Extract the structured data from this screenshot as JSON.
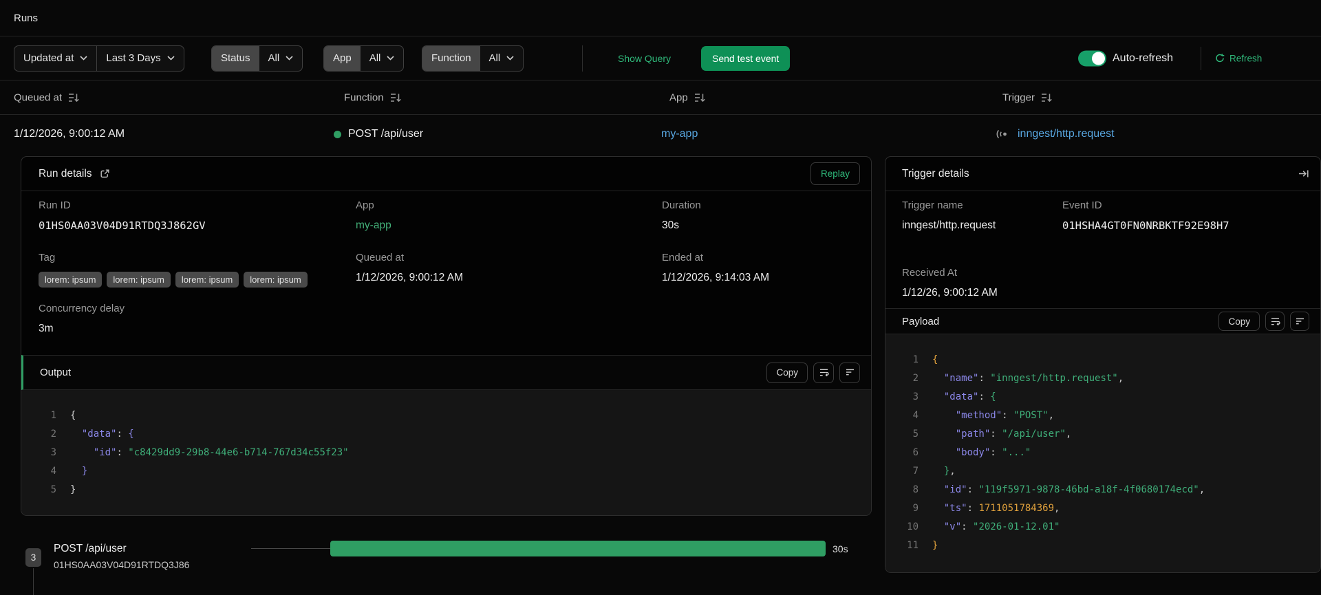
{
  "page": {
    "title": "Runs"
  },
  "filters": {
    "sort_field": "Updated at",
    "time_range": "Last 3 Days",
    "status_label": "Status",
    "status_value": "All",
    "app_label": "App",
    "app_value": "All",
    "function_label": "Function",
    "function_value": "All",
    "show_query_label": "Show Query",
    "send_test_event_label": "Send test event",
    "auto_refresh_label": "Auto-refresh",
    "auto_refresh_state": "on",
    "refresh_label": "Refresh"
  },
  "table": {
    "columns": [
      "Queued at",
      "Function",
      "App",
      "Trigger"
    ],
    "row": {
      "queued_at": "1/12/2026, 9:00:12 AM",
      "function": "POST /api/user",
      "status": "completed",
      "app": "my-app",
      "trigger": "inngest/http.request"
    }
  },
  "run_details": {
    "title": "Run details",
    "replay_label": "Replay",
    "run_id_label": "Run ID",
    "run_id": "01HS0AA03V04D91RTDQ3J862GV",
    "app_label": "App",
    "app": "my-app",
    "duration_label": "Duration",
    "duration": "30s",
    "tag_label": "Tag",
    "tags": [
      "lorem: ipsum",
      "lorem: ipsum",
      "lorem: ipsum",
      "lorem: ipsum"
    ],
    "queued_at_label": "Queued at",
    "queued_at": "1/12/2026, 9:00:12 AM",
    "ended_at_label": "Ended at",
    "ended_at": "1/12/2026, 9:14:03 AM",
    "concurrency_label": "Concurrency delay",
    "concurrency": "3m"
  },
  "output": {
    "title": "Output",
    "copy_label": "Copy",
    "lines": [
      [
        [
          "{",
          "brA"
        ]
      ],
      [
        [
          "  ",
          "pln"
        ],
        [
          "\"data\"",
          "key"
        ],
        [
          ": ",
          "pln"
        ],
        [
          "{",
          "brB"
        ]
      ],
      [
        [
          "    ",
          "pln"
        ],
        [
          "\"id\"",
          "key"
        ],
        [
          ": ",
          "pln"
        ],
        [
          "\"c8429dd9-29b8-44e6-b714-767d34c55f23\"",
          "str"
        ]
      ],
      [
        [
          "  ",
          "pln"
        ],
        [
          "}",
          "brB"
        ]
      ],
      [
        [
          "}",
          "brA"
        ]
      ]
    ]
  },
  "trigger_details": {
    "title": "Trigger details",
    "trigger_name_label": "Trigger name",
    "trigger_name": "inngest/http.request",
    "event_id_label": "Event ID",
    "event_id": "01HSHA4GT0FN0NRBKTF92E98H7",
    "received_at_label": "Received At",
    "received_at": "1/12/26, 9:00:12 AM"
  },
  "payload": {
    "title": "Payload",
    "copy_label": "Copy",
    "lines": [
      [
        [
          "{",
          "br0"
        ]
      ],
      [
        [
          "  ",
          "pln"
        ],
        [
          "\"name\"",
          "key"
        ],
        [
          ": ",
          "pln"
        ],
        [
          "\"inngest/http.request\"",
          "str"
        ],
        [
          ",",
          "pln"
        ]
      ],
      [
        [
          "  ",
          "pln"
        ],
        [
          "\"data\"",
          "key"
        ],
        [
          ": ",
          "pln"
        ],
        [
          "{",
          "br1"
        ]
      ],
      [
        [
          "    ",
          "pln"
        ],
        [
          "\"method\"",
          "key"
        ],
        [
          ": ",
          "pln"
        ],
        [
          "\"POST\"",
          "str"
        ],
        [
          ",",
          "pln"
        ]
      ],
      [
        [
          "    ",
          "pln"
        ],
        [
          "\"path\"",
          "key"
        ],
        [
          ": ",
          "pln"
        ],
        [
          "\"/api/user\"",
          "str"
        ],
        [
          ",",
          "pln"
        ]
      ],
      [
        [
          "    ",
          "pln"
        ],
        [
          "\"body\"",
          "key"
        ],
        [
          ": ",
          "pln"
        ],
        [
          "\"...\"",
          "str"
        ]
      ],
      [
        [
          "  ",
          "pln"
        ],
        [
          "}",
          "br1"
        ],
        [
          ",",
          "pln"
        ]
      ],
      [
        [
          "  ",
          "pln"
        ],
        [
          "\"id\"",
          "key"
        ],
        [
          ": ",
          "pln"
        ],
        [
          "\"119f5971-9878-46bd-a18f-4f0680174ecd\"",
          "str"
        ],
        [
          ",",
          "pln"
        ]
      ],
      [
        [
          "  ",
          "pln"
        ],
        [
          "\"ts\"",
          "key"
        ],
        [
          ": ",
          "pln"
        ],
        [
          "1711051784369",
          "num"
        ],
        [
          ",",
          "pln"
        ]
      ],
      [
        [
          "  ",
          "pln"
        ],
        [
          "\"v\"",
          "key"
        ],
        [
          ": ",
          "pln"
        ],
        [
          "\"2026-01-12.01\"",
          "str"
        ]
      ],
      [
        [
          "}",
          "br0"
        ]
      ]
    ]
  },
  "timeline": {
    "step_count": "3",
    "function_name": "POST /api/user",
    "run_id": "01HS0AA03V04D91RTDQ3J86",
    "duration": "30s"
  },
  "colors": {
    "accent_green": "#0e9056",
    "link_green": "#2fb87a",
    "link_blue": "#58a6e0",
    "bar_green": "#2f9e63",
    "status_dot": "#2f9e63"
  }
}
